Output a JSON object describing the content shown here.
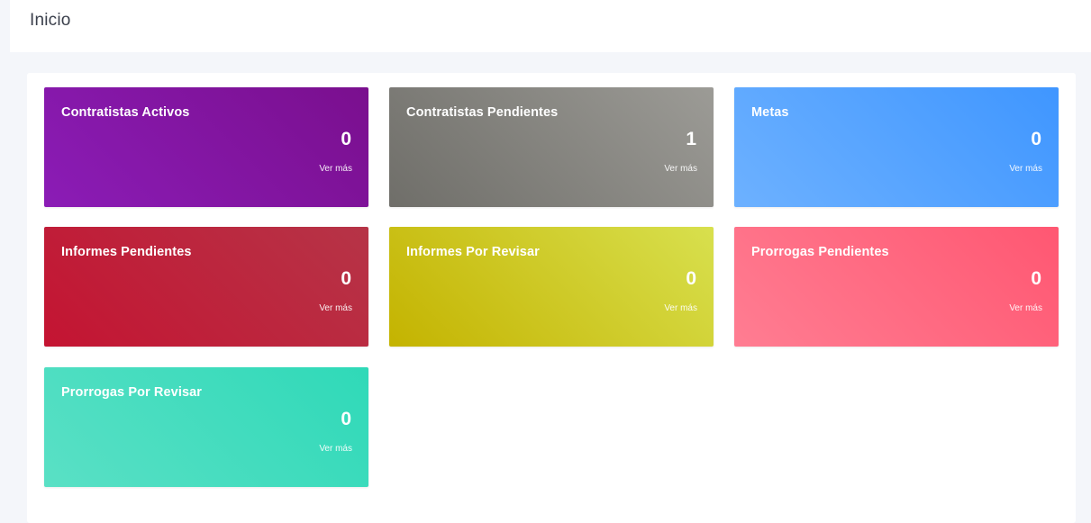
{
  "header": {
    "title": "Inicio"
  },
  "cards": [
    {
      "title": "Contratistas Activos",
      "count": "0",
      "link": "Ver más"
    },
    {
      "title": "Contratistas Pendientes",
      "count": "1",
      "link": "Ver más"
    },
    {
      "title": "Metas",
      "count": "0",
      "link": "Ver más"
    },
    {
      "title": "Informes Pendientes",
      "count": "0",
      "link": "Ver más"
    },
    {
      "title": "Informes Por Revisar",
      "count": "0",
      "link": "Ver más"
    },
    {
      "title": "Prorrogas Pendientes",
      "count": "0",
      "link": "Ver más"
    },
    {
      "title": "Prorrogas Por Revisar",
      "count": "0",
      "link": "Ver más"
    }
  ],
  "colors": {
    "contratistas_activos": "#8a1bb3",
    "contratistas_pendientes": "#8a8984",
    "metas": "#4a9dff",
    "informes_pendientes": "#bd1e3a",
    "informes_por_revisar": "#cfc824",
    "prorrogas_pendientes": "#ff6a82",
    "prorrogas_por_revisar": "#40dcbd"
  }
}
